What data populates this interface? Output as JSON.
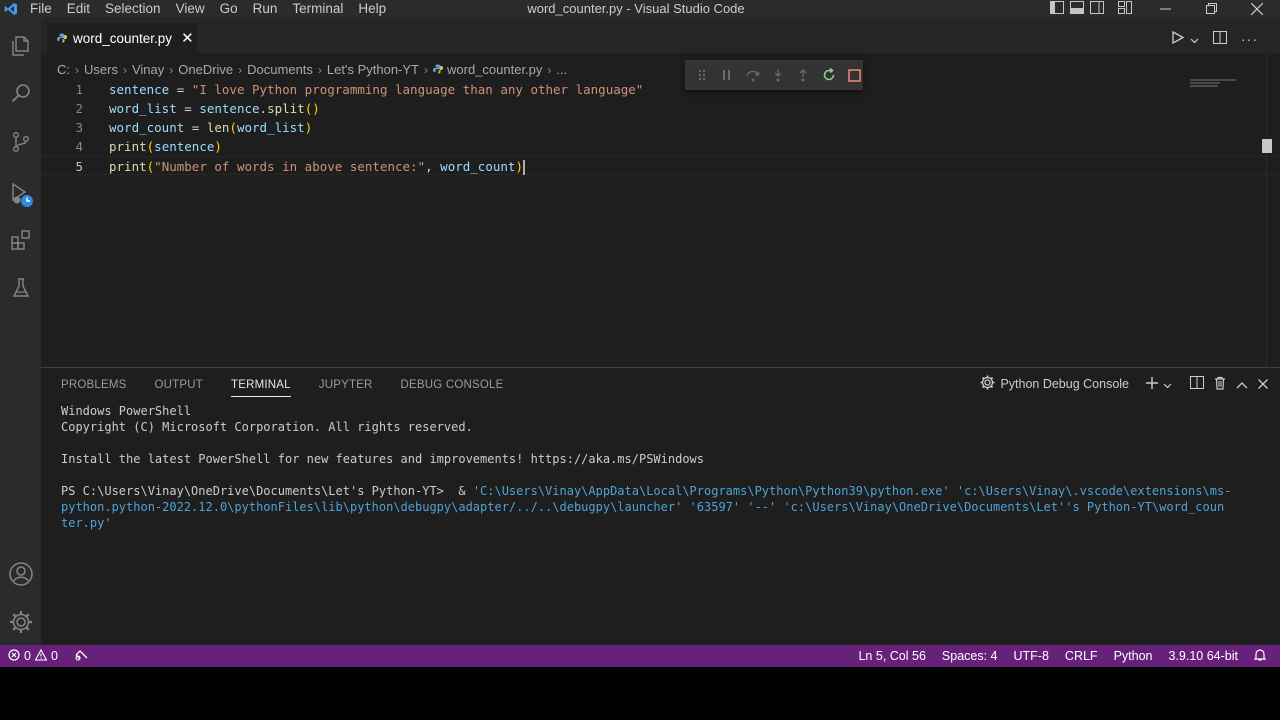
{
  "window": {
    "title": "word_counter.py - Visual Studio Code",
    "menu": [
      "File",
      "Edit",
      "Selection",
      "View",
      "Go",
      "Run",
      "Terminal",
      "Help"
    ]
  },
  "activity_bar": [
    "files-icon",
    "search-icon",
    "source-control-icon",
    "run-debug-icon",
    "extensions-icon",
    "testing-icon",
    "account-icon",
    "settings-gear-icon"
  ],
  "editor": {
    "tab": {
      "label": "word_counter.py",
      "close": "✕"
    },
    "breadcrumb": [
      "C:",
      "Users",
      "Vinay",
      "OneDrive",
      "Documents",
      "Let's Python-YT",
      "word_counter.py",
      "..."
    ],
    "lines": [
      {
        "num": "1",
        "parts": [
          [
            "var",
            "sentence"
          ],
          [
            "op",
            " = "
          ],
          [
            "str",
            "\"I love Python programming language than any other language\""
          ]
        ]
      },
      {
        "num": "2",
        "parts": [
          [
            "var",
            "word_list"
          ],
          [
            "op",
            " = "
          ],
          [
            "var",
            "sentence"
          ],
          [
            "op",
            "."
          ],
          [
            "fn",
            "split"
          ],
          [
            "br",
            "()"
          ]
        ]
      },
      {
        "num": "3",
        "parts": [
          [
            "var",
            "word_count"
          ],
          [
            "op",
            " = "
          ],
          [
            "fn",
            "len"
          ],
          [
            "br",
            "("
          ],
          [
            "var",
            "word_list"
          ],
          [
            "br",
            ")"
          ]
        ]
      },
      {
        "num": "4",
        "parts": [
          [
            "fn",
            "print"
          ],
          [
            "br",
            "("
          ],
          [
            "var",
            "sentence"
          ],
          [
            "br",
            ")"
          ]
        ]
      },
      {
        "num": "5",
        "parts": [
          [
            "fn",
            "print"
          ],
          [
            "br",
            "("
          ],
          [
            "str",
            "\"Number of words in above sentence:\""
          ],
          [
            "op",
            ", "
          ],
          [
            "var",
            "word_count"
          ],
          [
            "br",
            ")"
          ]
        ]
      }
    ]
  },
  "panel": {
    "tabs": [
      "PROBLEMS",
      "OUTPUT",
      "TERMINAL",
      "JUPYTER",
      "DEBUG CONSOLE"
    ],
    "active_tab": "TERMINAL",
    "console_label": "Python Debug Console",
    "terminal": {
      "line1": "Windows PowerShell",
      "line2": "Copyright (C) Microsoft Corporation. All rights reserved.",
      "line3": "Install the latest PowerShell for new features and improvements! https://aka.ms/PSWindows",
      "prompt": "PS C:\\Users\\Vinay\\OneDrive\\Documents\\Let's Python-YT>  & ",
      "cmd1": "'C:\\Users\\Vinay\\AppData\\Local\\Programs\\Python\\Python39\\python.exe' 'c:\\Users\\Vinay\\.vscode\\extensions\\ms-",
      "cmd2": "python.python-2022.12.0\\pythonFiles\\lib\\python\\debugpy\\adapter/../..\\debugpy\\launcher' '63597' '--' 'c:\\Users\\Vinay\\OneDrive\\Documents\\Let''s Python-YT\\word_coun",
      "cmd3": "ter.py'"
    }
  },
  "status": {
    "errors": "0",
    "warnings": "0",
    "position": "Ln 5, Col 56",
    "spaces": "Spaces: 4",
    "encoding": "UTF-8",
    "eol": "CRLF",
    "language": "Python",
    "interpreter": "3.9.10 64-bit"
  },
  "colors": {
    "status_bar": "#68217a",
    "editor_bg": "#1e1e1e",
    "activity_bar": "#2b2b2b"
  }
}
